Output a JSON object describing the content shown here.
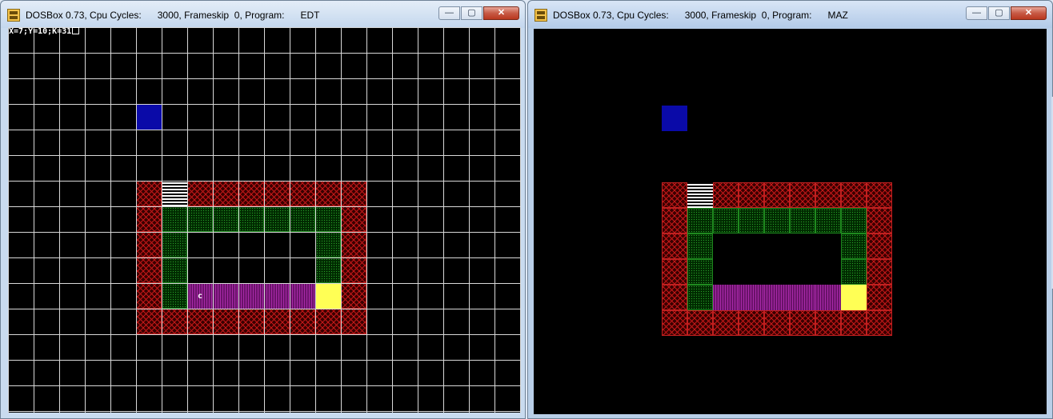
{
  "windows": [
    {
      "id": "left",
      "title": "DOSBox 0.73, Cpu Cycles:      3000, Frameskip  0, Program:      EDT",
      "controls": {
        "minimize": "—",
        "maximize": "▢",
        "close": "✕"
      },
      "status_text": "X=7;Y=10;K=31",
      "marker_char": "c",
      "show_grid": true
    },
    {
      "id": "right",
      "title": "DOSBox 0.73, Cpu Cycles:      3000, Frameskip  0, Program:      MAZ",
      "controls": {
        "minimize": "—",
        "maximize": "▢",
        "close": "✕"
      },
      "show_grid": false
    }
  ],
  "tile_legend": {
    "wall": "#c01818",
    "grass": "#1f8a1f",
    "purple": "#a82aa8",
    "ladder": "#ffffff",
    "yellow": "#ffff55",
    "blue": "#0a0aa8"
  },
  "tiles": [
    {
      "type": "blue",
      "col": 5,
      "row": 3
    },
    {
      "type": "wall",
      "col": 5,
      "row": 6
    },
    {
      "type": "ladder",
      "col": 6,
      "row": 6
    },
    {
      "type": "wall",
      "col": 7,
      "row": 6
    },
    {
      "type": "wall",
      "col": 8,
      "row": 6
    },
    {
      "type": "wall",
      "col": 9,
      "row": 6
    },
    {
      "type": "wall",
      "col": 10,
      "row": 6
    },
    {
      "type": "wall",
      "col": 11,
      "row": 6
    },
    {
      "type": "wall",
      "col": 12,
      "row": 6
    },
    {
      "type": "wall",
      "col": 13,
      "row": 6
    },
    {
      "type": "wall",
      "col": 5,
      "row": 7
    },
    {
      "type": "grass",
      "col": 6,
      "row": 7
    },
    {
      "type": "grass",
      "col": 7,
      "row": 7
    },
    {
      "type": "grass",
      "col": 8,
      "row": 7
    },
    {
      "type": "grass",
      "col": 9,
      "row": 7
    },
    {
      "type": "grass",
      "col": 10,
      "row": 7
    },
    {
      "type": "grass",
      "col": 11,
      "row": 7
    },
    {
      "type": "grass",
      "col": 12,
      "row": 7
    },
    {
      "type": "wall",
      "col": 13,
      "row": 7
    },
    {
      "type": "wall",
      "col": 5,
      "row": 8
    },
    {
      "type": "grass",
      "col": 6,
      "row": 8
    },
    {
      "type": "grass",
      "col": 12,
      "row": 8
    },
    {
      "type": "wall",
      "col": 13,
      "row": 8
    },
    {
      "type": "wall",
      "col": 5,
      "row": 9
    },
    {
      "type": "grass",
      "col": 6,
      "row": 9
    },
    {
      "type": "grass",
      "col": 12,
      "row": 9
    },
    {
      "type": "wall",
      "col": 13,
      "row": 9
    },
    {
      "type": "wall",
      "col": 5,
      "row": 10
    },
    {
      "type": "grass",
      "col": 6,
      "row": 10
    },
    {
      "type": "purple",
      "col": 7,
      "row": 10
    },
    {
      "type": "purple",
      "col": 8,
      "row": 10
    },
    {
      "type": "purple",
      "col": 9,
      "row": 10
    },
    {
      "type": "purple",
      "col": 10,
      "row": 10
    },
    {
      "type": "purple",
      "col": 11,
      "row": 10
    },
    {
      "type": "yellow",
      "col": 12,
      "row": 10
    },
    {
      "type": "wall",
      "col": 13,
      "row": 10
    },
    {
      "type": "wall",
      "col": 5,
      "row": 11
    },
    {
      "type": "wall",
      "col": 6,
      "row": 11
    },
    {
      "type": "wall",
      "col": 7,
      "row": 11
    },
    {
      "type": "wall",
      "col": 8,
      "row": 11
    },
    {
      "type": "wall",
      "col": 9,
      "row": 11
    },
    {
      "type": "wall",
      "col": 10,
      "row": 11
    },
    {
      "type": "wall",
      "col": 11,
      "row": 11
    },
    {
      "type": "wall",
      "col": 12,
      "row": 11
    },
    {
      "type": "wall",
      "col": 13,
      "row": 11
    }
  ],
  "marker_tile": {
    "col": 7,
    "row": 10
  }
}
